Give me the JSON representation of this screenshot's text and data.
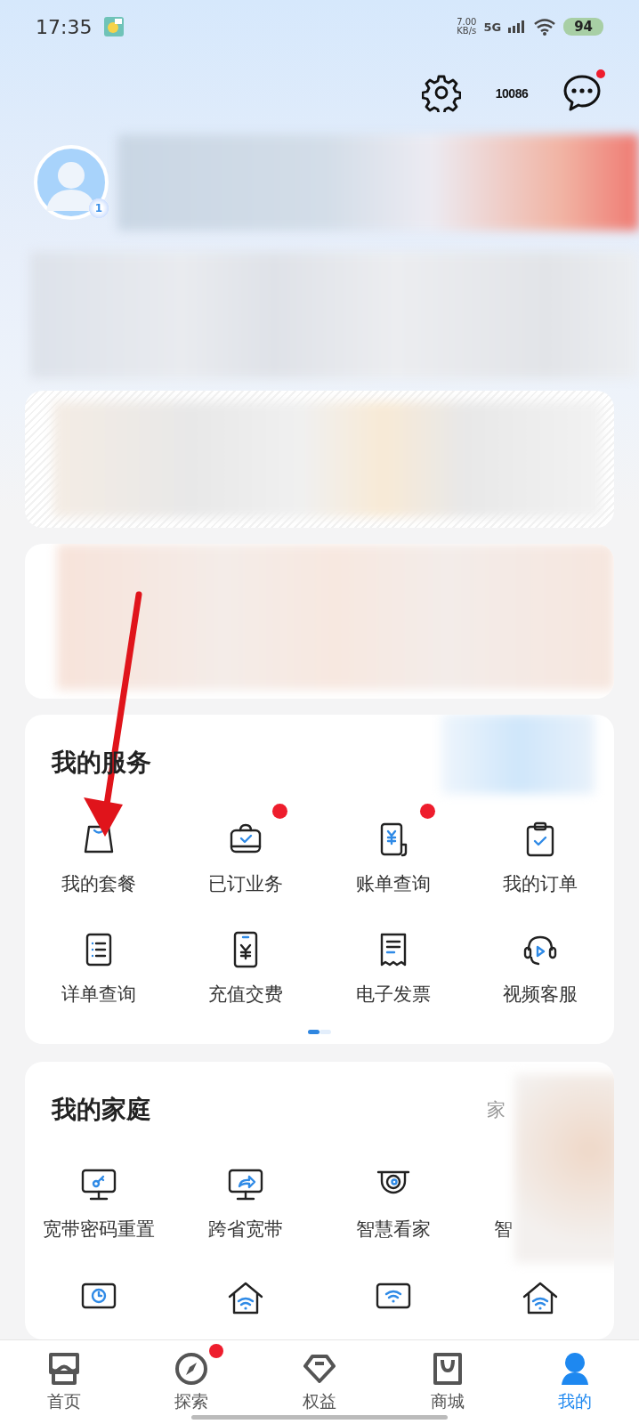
{
  "status_bar": {
    "time": "17:35",
    "net_speed": "7.00",
    "net_unit": "KB/s",
    "network": "5G",
    "battery": "94"
  },
  "header": {
    "hotline": "10086",
    "message_badge": true
  },
  "profile": {
    "level": "1"
  },
  "services": {
    "title": "我的服务",
    "items": [
      {
        "label": "我的套餐",
        "kind": "bag",
        "badge": false
      },
      {
        "label": "已订业务",
        "kind": "case",
        "badge": true
      },
      {
        "label": "账单查询",
        "kind": "bill",
        "badge": true
      },
      {
        "label": "我的订单",
        "kind": "clipboard",
        "badge": false
      },
      {
        "label": "详单查询",
        "kind": "list",
        "badge": false
      },
      {
        "label": "充值交费",
        "kind": "phone",
        "badge": false
      },
      {
        "label": "电子发票",
        "kind": "receipt",
        "badge": false
      },
      {
        "label": "视频客服",
        "kind": "headset",
        "badge": false
      }
    ],
    "pages": [
      {
        "selected": true
      },
      {
        "selected": false
      }
    ]
  },
  "family": {
    "title": "我的家庭",
    "link": "家",
    "items": [
      {
        "label": "宽带密码重置",
        "kind": "monitor-key"
      },
      {
        "label": "跨省宽带",
        "kind": "monitor-share"
      },
      {
        "label": "智慧看家",
        "kind": "camera"
      },
      {
        "label": "智",
        "kind": "none"
      },
      {
        "kind": "monitor-clock"
      },
      {
        "kind": "house-wifi"
      },
      {
        "kind": "monitor-wifi"
      },
      {
        "kind": "house-wifi"
      }
    ]
  },
  "tabs": [
    {
      "label": "首页",
      "kind": "home",
      "selected": false,
      "badge": false
    },
    {
      "label": "探索",
      "kind": "compass",
      "selected": false,
      "badge": true
    },
    {
      "label": "权益",
      "kind": "gem",
      "selected": false,
      "badge": false
    },
    {
      "label": "商城",
      "kind": "shop",
      "selected": false,
      "badge": false
    },
    {
      "label": "我的",
      "kind": "user",
      "selected": true,
      "badge": false
    }
  ]
}
